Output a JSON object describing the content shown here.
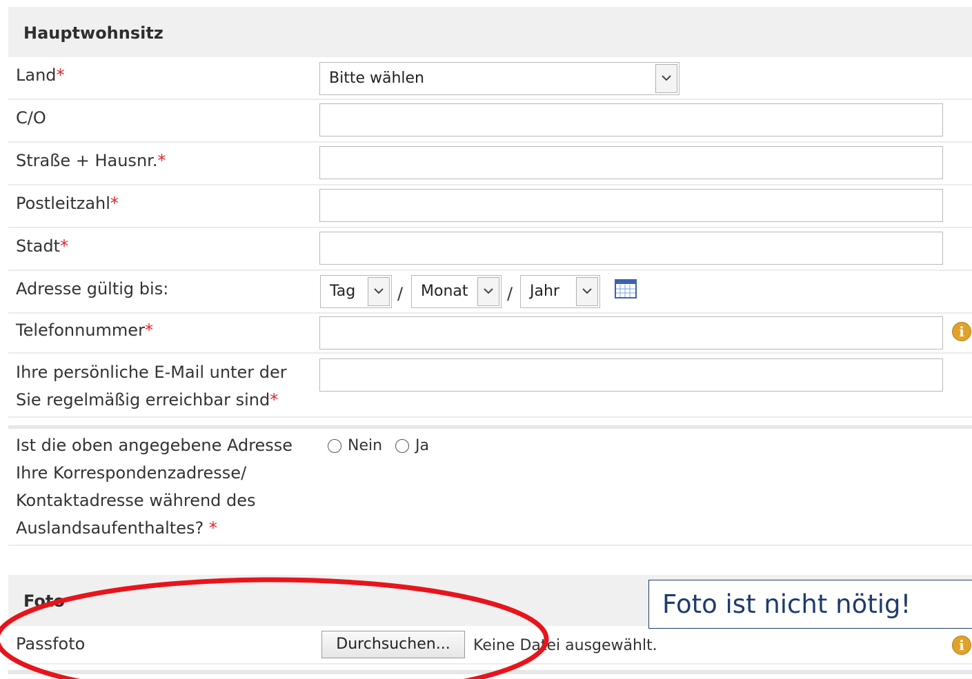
{
  "section_address": {
    "title": "Hauptwohnsitz",
    "country_label": "Land",
    "country_value": "Bitte wählen",
    "co_label": "C/O",
    "street_label": "Straße + Hausnr.",
    "zip_label": "Postleitzahl",
    "city_label": "Stadt",
    "valid_until_label": "Adresse gültig bis:",
    "day_value": "Tag",
    "month_value": "Monat",
    "year_value": "Jahr",
    "date_separator": "/",
    "phone_label": "Telefonnummer",
    "email_label_line1": "Ihre persönliche E-Mail unter der",
    "email_label_line2": "Sie regelmäßig erreichbar sind",
    "correspondence_line1": "Ist die oben angegebene Adresse",
    "correspondence_line2": "Ihre Korrespondenzadresse/",
    "correspondence_line3": "Kontaktadresse während des",
    "correspondence_line4": "Auslandsaufenthaltes?",
    "radio_no": "Nein",
    "radio_yes": "Ja",
    "required_marker": "*"
  },
  "section_photo": {
    "title": "Foto",
    "passport_label": "Passfoto",
    "browse_button": "Durchsuchen...",
    "no_file_text": "Keine Datei ausgewählt."
  },
  "annotation": {
    "callout_text": "Foto ist nicht nötig!",
    "ellipse_color": "#e8141b"
  },
  "icons": {
    "info": "info-icon",
    "calendar": "calendar-icon"
  }
}
